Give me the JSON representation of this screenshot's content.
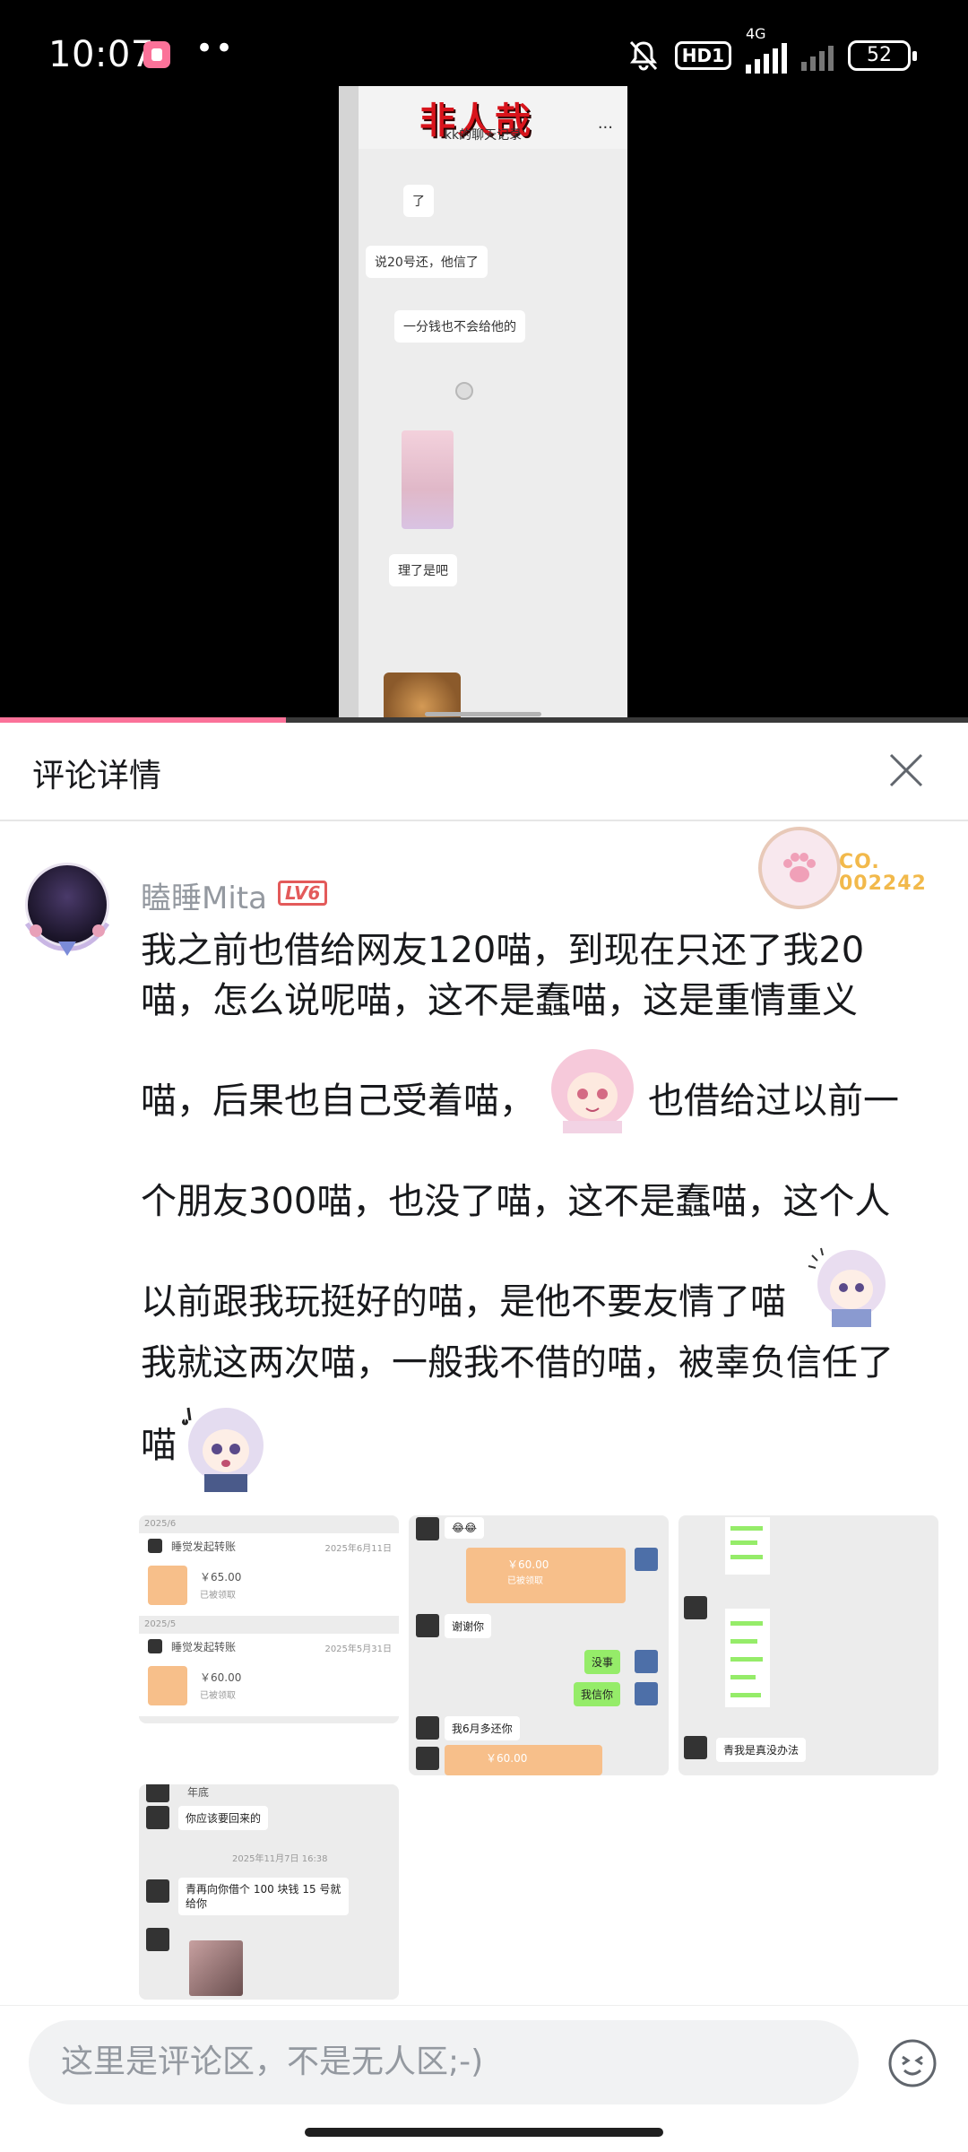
{
  "status_bar": {
    "time": "10:07",
    "hd_label": "HD1",
    "network": "4G",
    "battery": "52"
  },
  "video": {
    "overlay_text": "非人哉",
    "chat_title": "kk的聊天记录",
    "more": "···",
    "bubbles": [
      "了",
      "说20号还，他信了",
      "一分钱也不会给他的",
      "理了是吧"
    ],
    "progress": 0.295
  },
  "sheet": {
    "title": "评论详情"
  },
  "comment": {
    "username": "瞌睡Mita",
    "level": "LV6",
    "fan_number": "CO.\n002242",
    "lines": [
      "我之前也借给网友120喵，到现在只还了我20",
      "喵，怎么说呢喵，这不是蠢喵，这是重情重义",
      "喵，后果也自己受着喵，",
      "也借给过以前一",
      "个朋友300喵，也没了喵，这不是蠢喵，这个人",
      "以前跟我玩挺好的喵，是他不要友情了喵",
      "我就这两次喵，一般我不借的喵，被辜负信任了",
      "喵"
    ]
  },
  "images": {
    "img1": {
      "month1": "2025/6",
      "title1": "睡觉发起转账",
      "date1": "2025年6月11日",
      "amount1": "￥65.00",
      "status1": "已被领取",
      "month2": "2025/5",
      "title2": "睡觉发起转账",
      "date2": "2025年5月31日",
      "amount2": "￥60.00",
      "status2": "已被领取"
    },
    "img2": {
      "emoji": "😂😂",
      "amount": "￥60.00",
      "status": "已被领取",
      "thanks": "谢谢你",
      "reply1": "没事",
      "reply2": "我信你",
      "promise": "我6月多还你",
      "amount2": "￥60.00"
    },
    "img3": {
      "caption": "青我是真没办法"
    },
    "img4": {
      "top": "年底",
      "msg1": "你应该要回来的",
      "time": "2025年11月7日 16:38",
      "msg2": "青再向你借个 100 块钱 15 号就给你"
    }
  },
  "input": {
    "placeholder": "这里是评论区，不是无人区;-)"
  },
  "colors": {
    "accent": "#fb7299",
    "level": "#e35a5a",
    "wechat_green": "#95ec69",
    "transfer_orange": "#f7bf8a"
  },
  "icons": [
    "bilibili-app-icon",
    "mute-bell-icon",
    "signal-icon",
    "battery-icon",
    "close-icon",
    "emoji-icon",
    "paw-icon"
  ]
}
